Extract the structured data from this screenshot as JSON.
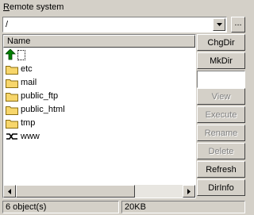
{
  "panel": {
    "title_first_letter": "R",
    "title_rest": "emote system"
  },
  "path": {
    "value": "/"
  },
  "browse_label": "...",
  "list": {
    "column_name": "Name",
    "items": [
      {
        "name": "",
        "icon": "up-arrow-icon"
      },
      {
        "name": "etc",
        "icon": "folder-icon"
      },
      {
        "name": "mail",
        "icon": "folder-icon"
      },
      {
        "name": "public_ftp",
        "icon": "folder-icon"
      },
      {
        "name": "public_html",
        "icon": "folder-icon"
      },
      {
        "name": "tmp",
        "icon": "folder-icon"
      },
      {
        "name": "www",
        "icon": "link-icon"
      }
    ]
  },
  "buttons": {
    "chgdir": "ChgDir",
    "mkdir": "MkDir",
    "view": "View",
    "execute": "Execute",
    "rename": "Rename",
    "delete": "Delete",
    "refresh": "Refresh",
    "dirinfo": "DirInfo"
  },
  "status": {
    "objects": "6 object(s)",
    "size": "20KB"
  },
  "colors": {
    "folder": "#f7d66b",
    "up_arrow": "#008000",
    "face": "#d4d0c8"
  }
}
